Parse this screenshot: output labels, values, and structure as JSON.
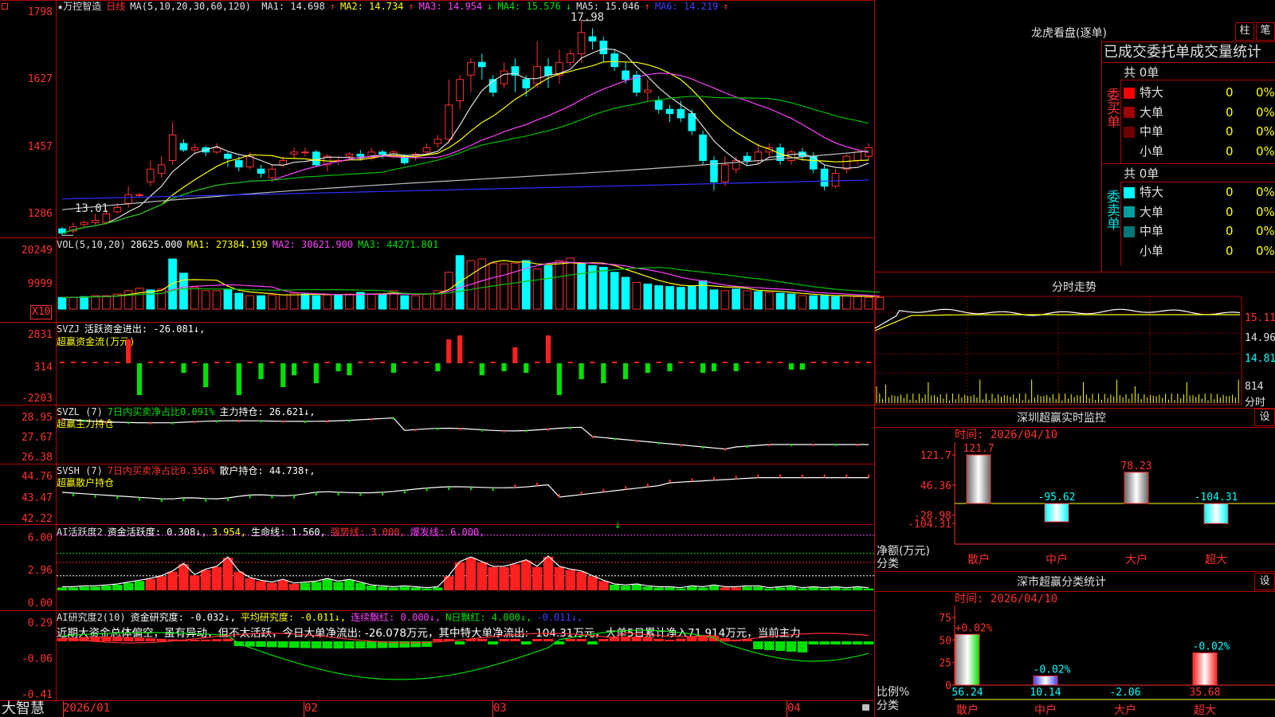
{
  "app": {
    "logo": "大智慧"
  },
  "kline": {
    "star": "★",
    "name": "万控智造",
    "period": "日线",
    "ma_params": "MA(5,10,20,30,60,120)",
    "ma": [
      {
        "label": "MA1: 14.698",
        "arrow": "↑",
        "color": "#e0e0e0"
      },
      {
        "label": "MA2: 14.734",
        "arrow": "↑",
        "color": "#ffff00"
      },
      {
        "label": "MA3: 14.954",
        "arrow": "↓",
        "color": "#ff40ff"
      },
      {
        "label": "MA4: 15.576",
        "arrow": "↓",
        "color": "#00e000"
      },
      {
        "label": "MA5: 15.046",
        "arrow": "↑",
        "color": "#e0e0e0"
      },
      {
        "label": "MA6: 14.219",
        "arrow": "↑",
        "color": "#4040ff"
      }
    ],
    "yaxis": [
      "1798",
      "1627",
      "1457",
      "1286"
    ],
    "high_label": "17.98",
    "low_label": "13.01",
    "candles": [
      {
        "o": 13.1,
        "c": 13.0,
        "h": 13.15,
        "l": 12.95
      },
      {
        "o": 13.05,
        "c": 13.15,
        "h": 13.25,
        "l": 13.0
      },
      {
        "o": 13.2,
        "c": 13.25,
        "h": 13.3,
        "l": 13.15
      },
      {
        "o": 13.25,
        "c": 13.3,
        "h": 13.45,
        "l": 13.2
      },
      {
        "o": 13.25,
        "c": 13.45,
        "h": 13.55,
        "l": 13.2
      },
      {
        "o": 13.5,
        "c": 13.6,
        "h": 13.7,
        "l": 13.45
      },
      {
        "o": 13.7,
        "c": 13.9,
        "h": 14.1,
        "l": 13.6
      },
      {
        "o": 13.9,
        "c": 13.9,
        "h": 13.95,
        "l": 13.85
      },
      {
        "o": 14.2,
        "c": 14.5,
        "h": 14.7,
        "l": 14.1
      },
      {
        "o": 14.4,
        "c": 14.6,
        "h": 14.8,
        "l": 14.3
      },
      {
        "o": 14.7,
        "c": 15.3,
        "h": 15.6,
        "l": 14.6
      },
      {
        "o": 15.1,
        "c": 14.95,
        "h": 15.2,
        "l": 14.9
      },
      {
        "o": 14.95,
        "c": 15.0,
        "h": 15.1,
        "l": 14.85
      },
      {
        "o": 15.0,
        "c": 14.9,
        "h": 15.05,
        "l": 14.8
      },
      {
        "o": 14.9,
        "c": 15.0,
        "h": 15.1,
        "l": 14.85
      },
      {
        "o": 14.85,
        "c": 14.75,
        "h": 14.9,
        "l": 14.55
      },
      {
        "o": 14.7,
        "c": 14.55,
        "h": 14.8,
        "l": 14.45
      },
      {
        "o": 14.55,
        "c": 14.8,
        "h": 14.9,
        "l": 14.5
      },
      {
        "o": 14.5,
        "c": 14.4,
        "h": 14.6,
        "l": 14.3
      },
      {
        "o": 14.3,
        "c": 14.5,
        "h": 14.6,
        "l": 14.2
      },
      {
        "o": 14.6,
        "c": 14.7,
        "h": 14.8,
        "l": 14.55
      },
      {
        "o": 14.85,
        "c": 14.9,
        "h": 15.0,
        "l": 14.75
      },
      {
        "o": 14.9,
        "c": 14.9,
        "h": 15.0,
        "l": 14.8
      },
      {
        "o": 14.9,
        "c": 14.6,
        "h": 14.95,
        "l": 14.55
      },
      {
        "o": 14.6,
        "c": 14.8,
        "h": 14.85,
        "l": 14.45
      },
      {
        "o": 14.7,
        "c": 14.7,
        "h": 14.8,
        "l": 14.6
      },
      {
        "o": 14.8,
        "c": 14.85,
        "h": 14.9,
        "l": 14.7
      },
      {
        "o": 14.85,
        "c": 14.8,
        "h": 14.95,
        "l": 14.7
      },
      {
        "o": 14.75,
        "c": 14.9,
        "h": 15.0,
        "l": 14.7
      },
      {
        "o": 14.9,
        "c": 14.85,
        "h": 14.95,
        "l": 14.75
      },
      {
        "o": 14.8,
        "c": 14.9,
        "h": 14.95,
        "l": 14.75
      },
      {
        "o": 14.8,
        "c": 14.65,
        "h": 14.85,
        "l": 14.6
      },
      {
        "o": 14.8,
        "c": 14.85,
        "h": 14.9,
        "l": 14.7
      },
      {
        "o": 14.9,
        "c": 15.0,
        "h": 15.1,
        "l": 14.85
      },
      {
        "o": 15.1,
        "c": 15.2,
        "h": 15.3,
        "l": 15.0
      },
      {
        "o": 15.2,
        "c": 16.0,
        "h": 16.6,
        "l": 15.1
      },
      {
        "o": 16.1,
        "c": 16.6,
        "h": 16.7,
        "l": 15.9
      },
      {
        "o": 16.7,
        "c": 17.0,
        "h": 17.1,
        "l": 16.3
      },
      {
        "o": 17.0,
        "c": 16.9,
        "h": 17.2,
        "l": 16.6
      },
      {
        "o": 16.6,
        "c": 16.3,
        "h": 16.7,
        "l": 16.2
      },
      {
        "o": 16.5,
        "c": 16.8,
        "h": 17.0,
        "l": 16.4
      },
      {
        "o": 16.9,
        "c": 16.7,
        "h": 17.1,
        "l": 16.3
      },
      {
        "o": 16.6,
        "c": 16.4,
        "h": 16.7,
        "l": 16.2
      },
      {
        "o": 16.5,
        "c": 16.9,
        "h": 17.5,
        "l": 16.4
      },
      {
        "o": 16.9,
        "c": 16.7,
        "h": 17.1,
        "l": 16.4
      },
      {
        "o": 16.7,
        "c": 17.0,
        "h": 17.3,
        "l": 16.5
      },
      {
        "o": 17.0,
        "c": 17.2,
        "h": 17.3,
        "l": 16.9
      },
      {
        "o": 17.2,
        "c": 17.7,
        "h": 17.98,
        "l": 17.0
      },
      {
        "o": 17.6,
        "c": 17.5,
        "h": 17.8,
        "l": 17.3
      },
      {
        "o": 17.5,
        "c": 17.2,
        "h": 17.6,
        "l": 17.0
      },
      {
        "o": 17.2,
        "c": 16.9,
        "h": 17.3,
        "l": 16.8
      },
      {
        "o": 16.8,
        "c": 16.6,
        "h": 17.0,
        "l": 16.5
      },
      {
        "o": 16.7,
        "c": 16.3,
        "h": 16.8,
        "l": 16.2
      },
      {
        "o": 16.3,
        "c": 16.35,
        "h": 16.6,
        "l": 16.1
      },
      {
        "o": 16.1,
        "c": 15.9,
        "h": 16.2,
        "l": 15.8
      },
      {
        "o": 15.9,
        "c": 15.8,
        "h": 16.0,
        "l": 15.6
      },
      {
        "o": 15.9,
        "c": 15.7,
        "h": 16.1,
        "l": 15.6
      },
      {
        "o": 15.8,
        "c": 15.4,
        "h": 15.9,
        "l": 15.3
      },
      {
        "o": 15.3,
        "c": 14.7,
        "h": 15.4,
        "l": 14.6
      },
      {
        "o": 14.7,
        "c": 14.2,
        "h": 14.8,
        "l": 14.0
      },
      {
        "o": 14.2,
        "c": 14.6,
        "h": 14.8,
        "l": 14.1
      },
      {
        "o": 14.5,
        "c": 14.7,
        "h": 14.8,
        "l": 14.4
      },
      {
        "o": 14.8,
        "c": 14.7,
        "h": 14.9,
        "l": 14.6
      },
      {
        "o": 14.7,
        "c": 14.9,
        "h": 15.1,
        "l": 14.6
      },
      {
        "o": 14.9,
        "c": 15.0,
        "h": 15.1,
        "l": 14.8
      },
      {
        "o": 15.0,
        "c": 14.7,
        "h": 15.1,
        "l": 14.6
      },
      {
        "o": 14.7,
        "c": 14.9,
        "h": 14.95,
        "l": 14.6
      },
      {
        "o": 14.9,
        "c": 14.8,
        "h": 15.0,
        "l": 14.7
      },
      {
        "o": 14.8,
        "c": 14.5,
        "h": 14.9,
        "l": 14.4
      },
      {
        "o": 14.5,
        "c": 14.1,
        "h": 14.6,
        "l": 14.0
      },
      {
        "o": 14.1,
        "c": 14.4,
        "h": 14.5,
        "l": 14.05
      },
      {
        "o": 14.5,
        "c": 14.8,
        "h": 14.85,
        "l": 14.4
      },
      {
        "o": 14.7,
        "c": 14.9,
        "h": 14.95,
        "l": 14.6
      },
      {
        "o": 14.8,
        "c": 15.0,
        "h": 15.1,
        "l": 14.7
      }
    ]
  },
  "vol": {
    "title": "VOL(5,10,20)",
    "value": "28625.000",
    "ma1": "MA1: 27384.199",
    "ma2": "MA2: 30621.900",
    "ma3": "MA3: 44271.801",
    "yaxis": [
      "20249",
      "9999"
    ],
    "unit": "X10",
    "bars": [
      14,
      14,
      15,
      16,
      16,
      18,
      22,
      25,
      23,
      24,
      60,
      43,
      26,
      22,
      22,
      24,
      19,
      16,
      16,
      17,
      17,
      19,
      18,
      16,
      17,
      17,
      18,
      20,
      18,
      18,
      22,
      16,
      16,
      18,
      22,
      44,
      64,
      58,
      60,
      55,
      54,
      55,
      58,
      48,
      52,
      58,
      61,
      54,
      52,
      50,
      44,
      38,
      32,
      30,
      28,
      27,
      26,
      28,
      34,
      23,
      22,
      24,
      22,
      21,
      20,
      19,
      18,
      16,
      16,
      16,
      15,
      16,
      15,
      14,
      14
    ],
    "up": [
      0,
      1,
      0,
      1,
      1,
      1,
      1,
      1,
      0,
      1,
      0,
      0,
      1,
      1,
      1,
      0,
      0,
      1,
      0,
      1,
      1,
      1,
      0,
      0,
      1,
      0,
      1,
      0,
      1,
      0,
      1,
      0,
      1,
      1,
      1,
      1,
      0,
      1,
      1,
      1,
      1,
      1,
      0,
      1,
      0,
      1,
      1,
      0,
      0,
      0,
      0,
      0,
      1,
      0,
      0,
      0,
      0,
      0,
      0,
      0,
      1,
      0,
      1,
      0,
      1,
      0,
      0,
      1,
      0,
      0,
      0,
      1,
      1,
      1,
      1
    ]
  },
  "svzj": {
    "title": "SVZJ",
    "desc": "活跃资金进出: -26.081↓,",
    "sub": "超赢资金流(万元)",
    "yaxis": [
      "2831",
      "314",
      "-2203"
    ],
    "values": [
      2,
      2,
      2,
      2,
      2,
      2,
      30,
      -40,
      2,
      2,
      2,
      -12,
      2,
      -30,
      2,
      2,
      -40,
      2,
      -20,
      2,
      -30,
      -15,
      2,
      -25,
      2,
      -10,
      -15,
      2,
      2,
      2,
      -12,
      2,
      2,
      2,
      -10,
      30,
      35,
      2,
      -15,
      2,
      -10,
      20,
      -12,
      2,
      35,
      -40,
      2,
      -20,
      2,
      -25,
      2,
      -20,
      2,
      -12,
      2,
      -10,
      2,
      2,
      -12,
      -10,
      2,
      -10,
      2,
      2,
      2,
      2,
      -8,
      -8,
      2,
      2,
      2,
      2,
      2,
      2,
      2,
      2
    ]
  },
  "svzl": {
    "title": "SVZL (7)",
    "ratio": "7日内买卖净占比0.091%",
    "hold": "主力持仓: 26.621↓,",
    "sub": "超赢主力持仓",
    "yaxis": [
      "28.95",
      "27.67",
      "26.38"
    ]
  },
  "svsh": {
    "title": "SVSH (7)",
    "ratio": "7日内买卖净占比0.356%",
    "hold": "散户持仓: 44.738↑,",
    "sub": "超赢散户持仓",
    "yaxis": [
      "44.76",
      "43.47",
      "42.22"
    ]
  },
  "ai_active": {
    "title": "AI活跃度2",
    "desc": "资金活跃度: 0.308↓,",
    "v2": "3.954,",
    "life": "生命线: 1.560,",
    "strong": "强势线: 3.000,",
    "burst": "爆发线: 6.000,",
    "yaxis": [
      "6.00",
      "2.96",
      "0.00"
    ],
    "bars": [
      0.3,
      0.3,
      0.4,
      0.4,
      0.5,
      0.6,
      0.8,
      1.0,
      1.2,
      1.5,
      2.0,
      2.8,
      1.6,
      2.2,
      2.5,
      3.5,
      2.0,
      1.3,
      1.0,
      0.8,
      1.1,
      0.7,
      0.8,
      0.9,
      1.2,
      0.9,
      1.1,
      0.8,
      0.5,
      0.4,
      0.3,
      0.4,
      0.3,
      0.2,
      0.3,
      1.5,
      3.0,
      3.5,
      3.0,
      2.5,
      2.5,
      2.8,
      3.2,
      2.5,
      3.6,
      2.5,
      2.2,
      2.0,
      1.5,
      1.0,
      0.6,
      0.5,
      0.6,
      0.4,
      0.3,
      0.3,
      0.2,
      0.4,
      0.3,
      0.5,
      0.3,
      0.3,
      0.4,
      0.4,
      0.2,
      0.3,
      0.4,
      0.2,
      0.3,
      0.2,
      0.3,
      0.2,
      0.3,
      0.2,
      0.3,
      0.3
    ],
    "red": [
      0,
      0,
      0,
      0,
      0,
      0,
      0,
      0,
      1,
      1,
      1,
      1,
      1,
      1,
      1,
      1,
      1,
      1,
      1,
      1,
      1,
      1,
      0,
      0,
      0,
      0,
      0,
      0,
      0,
      0,
      0,
      0,
      0,
      0,
      0,
      1,
      1,
      1,
      1,
      1,
      1,
      1,
      1,
      1,
      1,
      1,
      1,
      1,
      1,
      1,
      0,
      0,
      0,
      0,
      0,
      0,
      0,
      0,
      0,
      0,
      1,
      1,
      0,
      0,
      0,
      0,
      0,
      0,
      0,
      0,
      0,
      0,
      0,
      0,
      0,
      0
    ]
  },
  "ai_research": {
    "title": "AI研究度2(10)",
    "desc": "资金研究度: -0.032↓,",
    "avg": "平均研究度: -0.011↓,",
    "streak": "连续飘红: 0.000↓,",
    "nday": "N日飘红: 4.000↓,",
    "last": "-0.011↓,",
    "comment": "近期大资金总体偏空，虽有异动，但不太活跃，今日大单净流出: -26.078万元，其中特大单净流出: -104.31万元，大单5日累计净入71.914万元，当前主力",
    "yaxis": [
      "0.29",
      "-0.06",
      "-0.41"
    ]
  },
  "dates": [
    "2026/01",
    "02",
    "03",
    "04"
  ],
  "lhb": {
    "title": "龙虎看盘(逐单)",
    "btn1": "柱",
    "btn2": "笔",
    "tabs": "已成交委托单成交量统计",
    "buy_label": "委买单",
    "sell_label": "委卖单",
    "buy_total": "共 0单",
    "sell_total": "共 0单",
    "buy_rows": [
      {
        "name": "特大",
        "n": "0",
        "p": "0%",
        "color": "#ff0000"
      },
      {
        "name": "大单",
        "n": "0",
        "p": "0%",
        "color": "#a00000"
      },
      {
        "name": "中单",
        "n": "0",
        "p": "0%",
        "color": "#700000"
      },
      {
        "name": "小单",
        "n": "0",
        "p": "0%",
        "color": "#000000"
      }
    ],
    "sell_rows": [
      {
        "name": "特大",
        "n": "0",
        "p": "0%",
        "color": "#00ffff"
      },
      {
        "name": "大单",
        "n": "0",
        "p": "0%",
        "color": "#00a0a0"
      },
      {
        "name": "中单",
        "n": "0",
        "p": "0%",
        "color": "#007878"
      },
      {
        "name": "小单",
        "n": "0",
        "p": "0%",
        "color": "#000000"
      }
    ]
  },
  "fenshi": {
    "title": "分时走势",
    "yaxis": [
      "15.11",
      "14.96",
      "14.81"
    ],
    "vol_label": "814",
    "vol_unit": "分时"
  },
  "sz_monitor": {
    "title": "深圳超赢实时监控",
    "settings": "设",
    "time": "时间: 2026/04/10",
    "yaxis": [
      "121.7",
      "46.36",
      "-28.98",
      "-104.31"
    ],
    "axis_title": "净额(万元)",
    "axis_sub": "分类",
    "cats": [
      "散户",
      "中户",
      "大户",
      "超大"
    ],
    "values": [
      121.7,
      -95.62,
      78.23,
      -104.31
    ],
    "labels": [
      "121.7",
      "-95.62",
      "78.23",
      "-104.31"
    ]
  },
  "sz_class": {
    "title": "深市超赢分类统计",
    "settings": "设",
    "time": "时间: 2026/04/10",
    "yaxis": [
      "75",
      "50",
      "25",
      "0"
    ],
    "axis_title": "比例%",
    "axis_sub": "分类",
    "cats": [
      "散户",
      "中户",
      "大户",
      "超大"
    ],
    "values": [
      56.24,
      10.14,
      -2.06,
      35.68
    ],
    "pct_labels": [
      "+0.02%",
      "-0.02%",
      "",
      "-0.02%"
    ],
    "bottom_labels": [
      "56.24",
      "10.14",
      "-2.06",
      "35.68"
    ]
  }
}
